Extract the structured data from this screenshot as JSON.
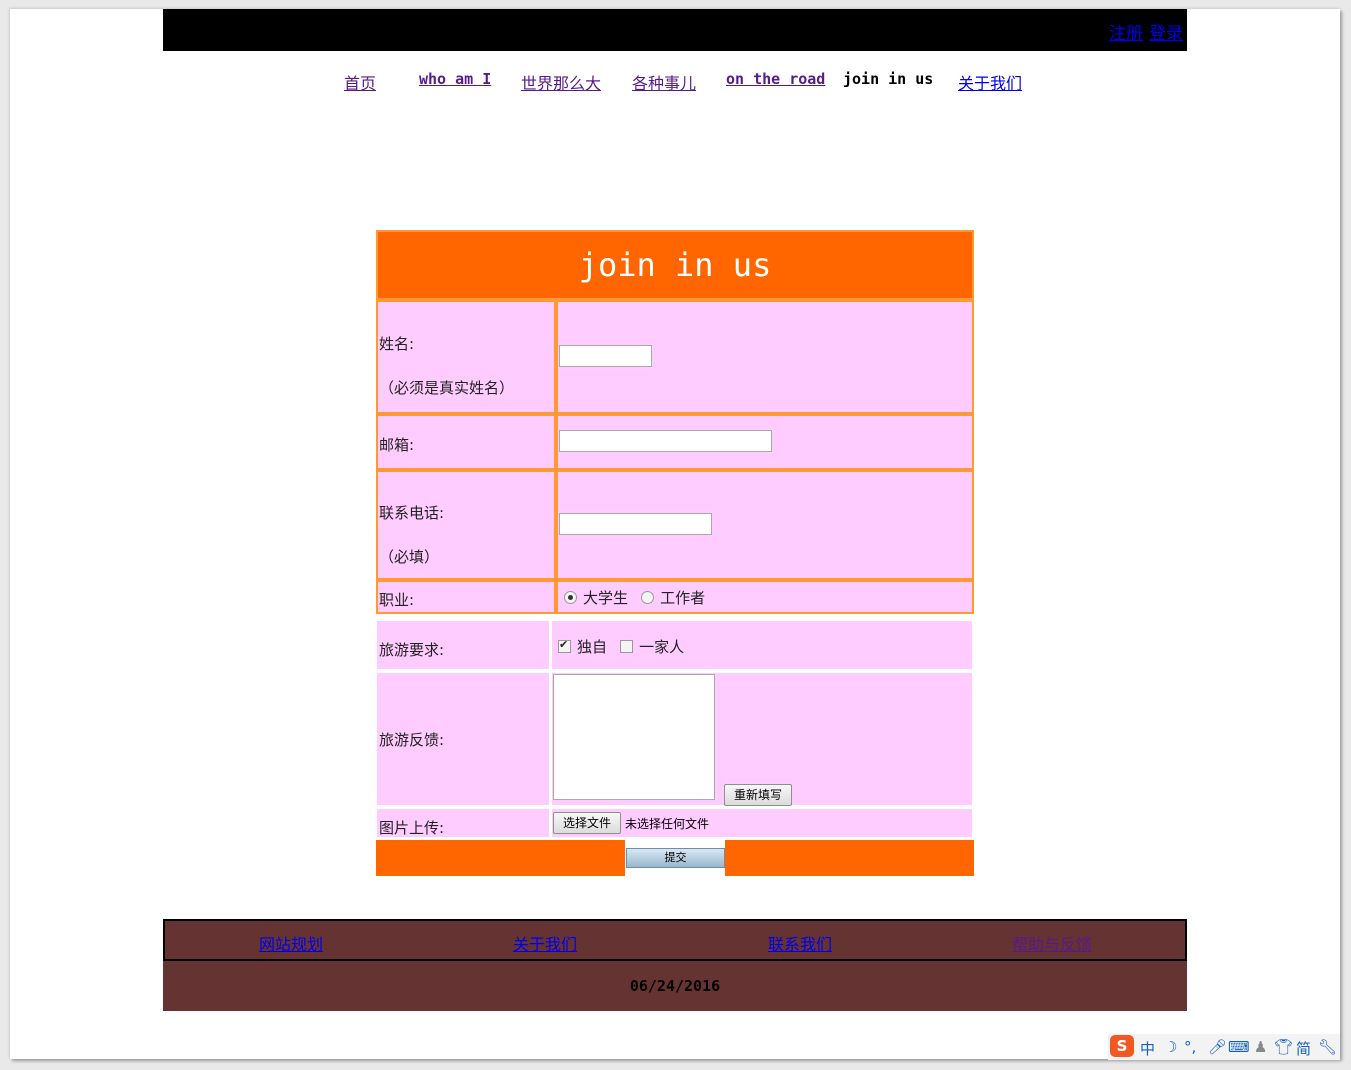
{
  "topbar": {
    "register": "注册",
    "login": "登录"
  },
  "nav": [
    {
      "label": "首页",
      "state": "visited"
    },
    {
      "label": "who am I",
      "state": "visited"
    },
    {
      "label": "世界那么大",
      "state": "visited"
    },
    {
      "label": "各种事儿",
      "state": "visited"
    },
    {
      "label": "on the road",
      "state": "visited"
    },
    {
      "label": "join in us",
      "state": "current"
    },
    {
      "label": "关于我们",
      "state": "link"
    }
  ],
  "form": {
    "title": "join in us",
    "name_label": "姓名:",
    "name_note": "（必须是真实姓名）",
    "email_label": "邮箱:",
    "phone_label": "联系电话:",
    "phone_note": "（必填）",
    "job_label": "职业:",
    "job_options": [
      "大学生",
      "工作者"
    ],
    "job_selected": "大学生",
    "travel_req_label": "旅游要求:",
    "travel_options": [
      "独自",
      "一家人"
    ],
    "travel_checked": [
      "独自"
    ],
    "feedback_label": "旅游反馈:",
    "reset_label": "重新填写",
    "upload_label": "图片上传:",
    "choose_file_label": "选择文件",
    "no_file_text": "未选择任何文件",
    "submit_label": "提交"
  },
  "footer": {
    "links": [
      "网站规划",
      "关于我们",
      "联系我们",
      "帮助与反馈"
    ],
    "date": "06/24/2016"
  },
  "ime": {
    "items": [
      "中",
      "简"
    ]
  },
  "colors": {
    "header_orange": "#ff6600",
    "border_orange": "#ff9933",
    "form_pink": "#ffccff",
    "footer_brown": "#663333",
    "link_blue": "#0000ee",
    "visited_purple": "#551a8b"
  }
}
